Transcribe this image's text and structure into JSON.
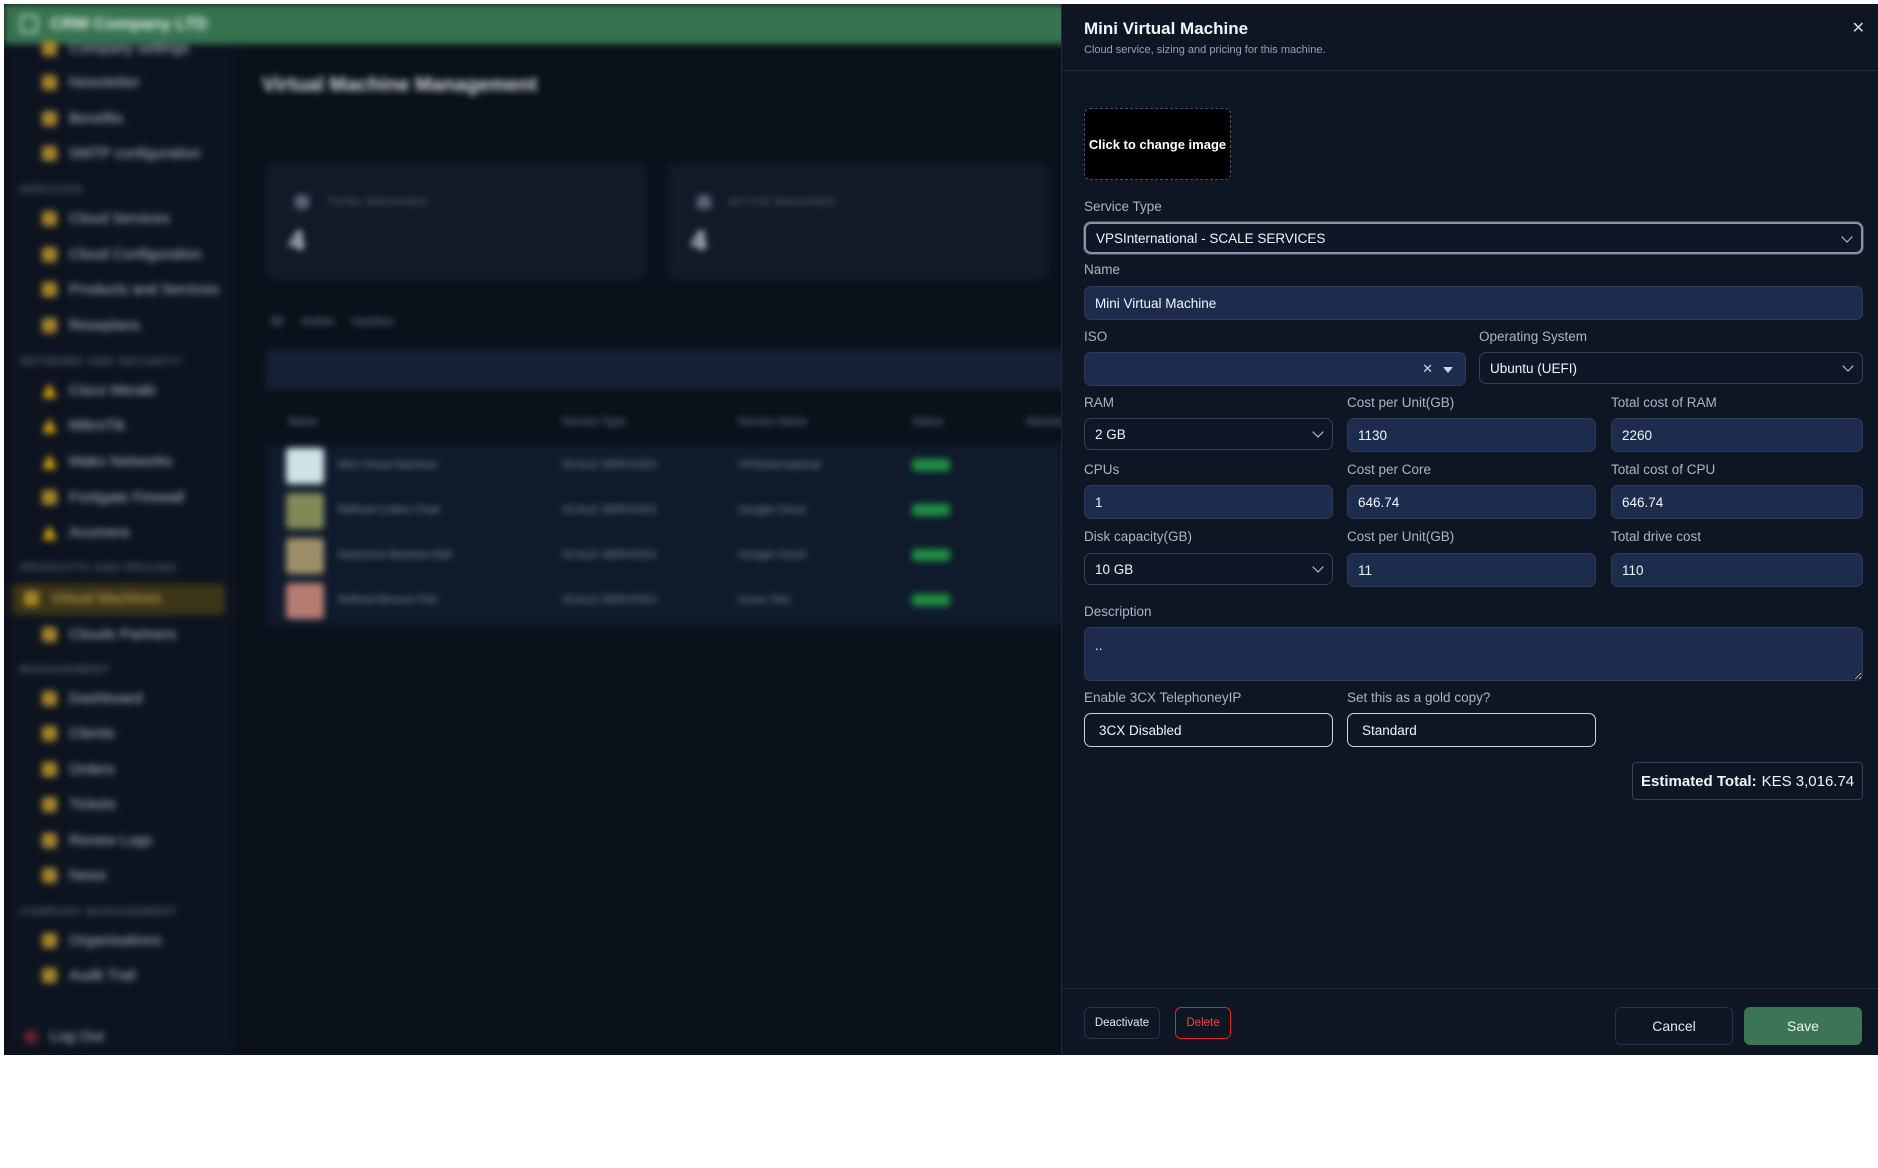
{
  "app": {
    "company": "CRM Company LTD"
  },
  "sidebar": {
    "items": [
      {
        "label": "Company settings"
      },
      {
        "label": "Newsletter"
      },
      {
        "label": "Benefits"
      },
      {
        "label": "SMTP configuration"
      },
      {
        "section": "SERVICES"
      },
      {
        "label": "Cloud Services"
      },
      {
        "label": "Cloud Configuration"
      },
      {
        "label": "Products and Services"
      },
      {
        "label": "Reseplans"
      },
      {
        "section": "NETWORK AND SECURITY"
      },
      {
        "label": "Cisco Meraki"
      },
      {
        "label": "MikroTik"
      },
      {
        "label": "Mako Networks"
      },
      {
        "label": "Fortigate Firewall"
      },
      {
        "label": "Acumera"
      },
      {
        "section": "PRODUCTS AND PRICING"
      },
      {
        "label": "Virtual Machines"
      },
      {
        "label": "Clouds Partners"
      },
      {
        "section": "MANAGEMENT"
      },
      {
        "label": "Dashboard"
      },
      {
        "label": "Clients"
      },
      {
        "label": "Orders"
      },
      {
        "label": "Tickets"
      },
      {
        "label": "Renew Logs"
      },
      {
        "label": "News"
      },
      {
        "section": "COMPANY MANAGEMENT"
      },
      {
        "label": "Organisations"
      },
      {
        "label": "Audit Trail"
      }
    ],
    "logout": "Log Out"
  },
  "main": {
    "title": "Virtual Machine Management",
    "stats": [
      {
        "label": "TOTAL MACHINES",
        "value": "4"
      },
      {
        "label": "ACTIVE MACHINES",
        "value": "4"
      }
    ],
    "filters": [
      "All",
      "Active",
      "Inactive"
    ],
    "table": {
      "headers": [
        "Name",
        "Service Type",
        "Service Name",
        "Status",
        "Machine"
      ],
      "rows": [
        {
          "name": "Mini Virtual Machine",
          "type": "SCALE SERVICES",
          "service": "VPSInternational"
        },
        {
          "name": "Refined Cotton Chair",
          "type": "SCALE SERVICES",
          "service": "Google Cloud"
        },
        {
          "name": "Awesome Bamboo Ball",
          "type": "SCALE SERVICES",
          "service": "Google Cloud"
        },
        {
          "name": "Refined Bronze Fish",
          "type": "SCALE SERVICES",
          "service": "Azure Test"
        }
      ]
    }
  },
  "drawer": {
    "title": "Mini Virtual Machine",
    "subtitle": "Cloud service, sizing and pricing for this machine.",
    "image_cta": "Click to change image",
    "service_type": {
      "label": "Service Type",
      "value": "VPSInternational - SCALE SERVICES"
    },
    "name": {
      "label": "Name",
      "value": "Mini Virtual Machine"
    },
    "iso": {
      "label": "ISO",
      "value": ""
    },
    "os": {
      "label": "Operating System",
      "value": "Ubuntu (UEFI)"
    },
    "ram": {
      "label": "RAM",
      "value": "2 GB"
    },
    "ram_cost": {
      "label": "Cost per Unit(GB)",
      "value": "1130"
    },
    "ram_total": {
      "label": "Total cost of RAM",
      "value": "2260"
    },
    "cpus": {
      "label": "CPUs",
      "value": "1"
    },
    "cpu_cost": {
      "label": "Cost per Core",
      "value": "646.74"
    },
    "cpu_total": {
      "label": "Total cost of CPU",
      "value": "646.74"
    },
    "disk": {
      "label": "Disk capacity(GB)",
      "value": "10 GB"
    },
    "disk_cost": {
      "label": "Cost per Unit(GB)",
      "value": "11"
    },
    "disk_total": {
      "label": "Total drive cost",
      "value": "110"
    },
    "description": {
      "label": "Description",
      "value": ".."
    },
    "telephony": {
      "label": "Enable 3CX TelephoneyIP",
      "value": "3CX Disabled"
    },
    "gold_copy": {
      "label": "Set this as a gold copy?",
      "value": "Standard"
    },
    "estimated": {
      "label": "Estimated Total:",
      "value": "KES 3,016.74"
    },
    "footer": {
      "deactivate": "Deactivate",
      "delete": "Delete",
      "cancel": "Cancel",
      "save": "Save"
    },
    "colors": {
      "accent": "#3e7456",
      "danger": "#dc2626",
      "field_bg": "#1d2b4d",
      "panel_bg": "#0e1624"
    }
  }
}
